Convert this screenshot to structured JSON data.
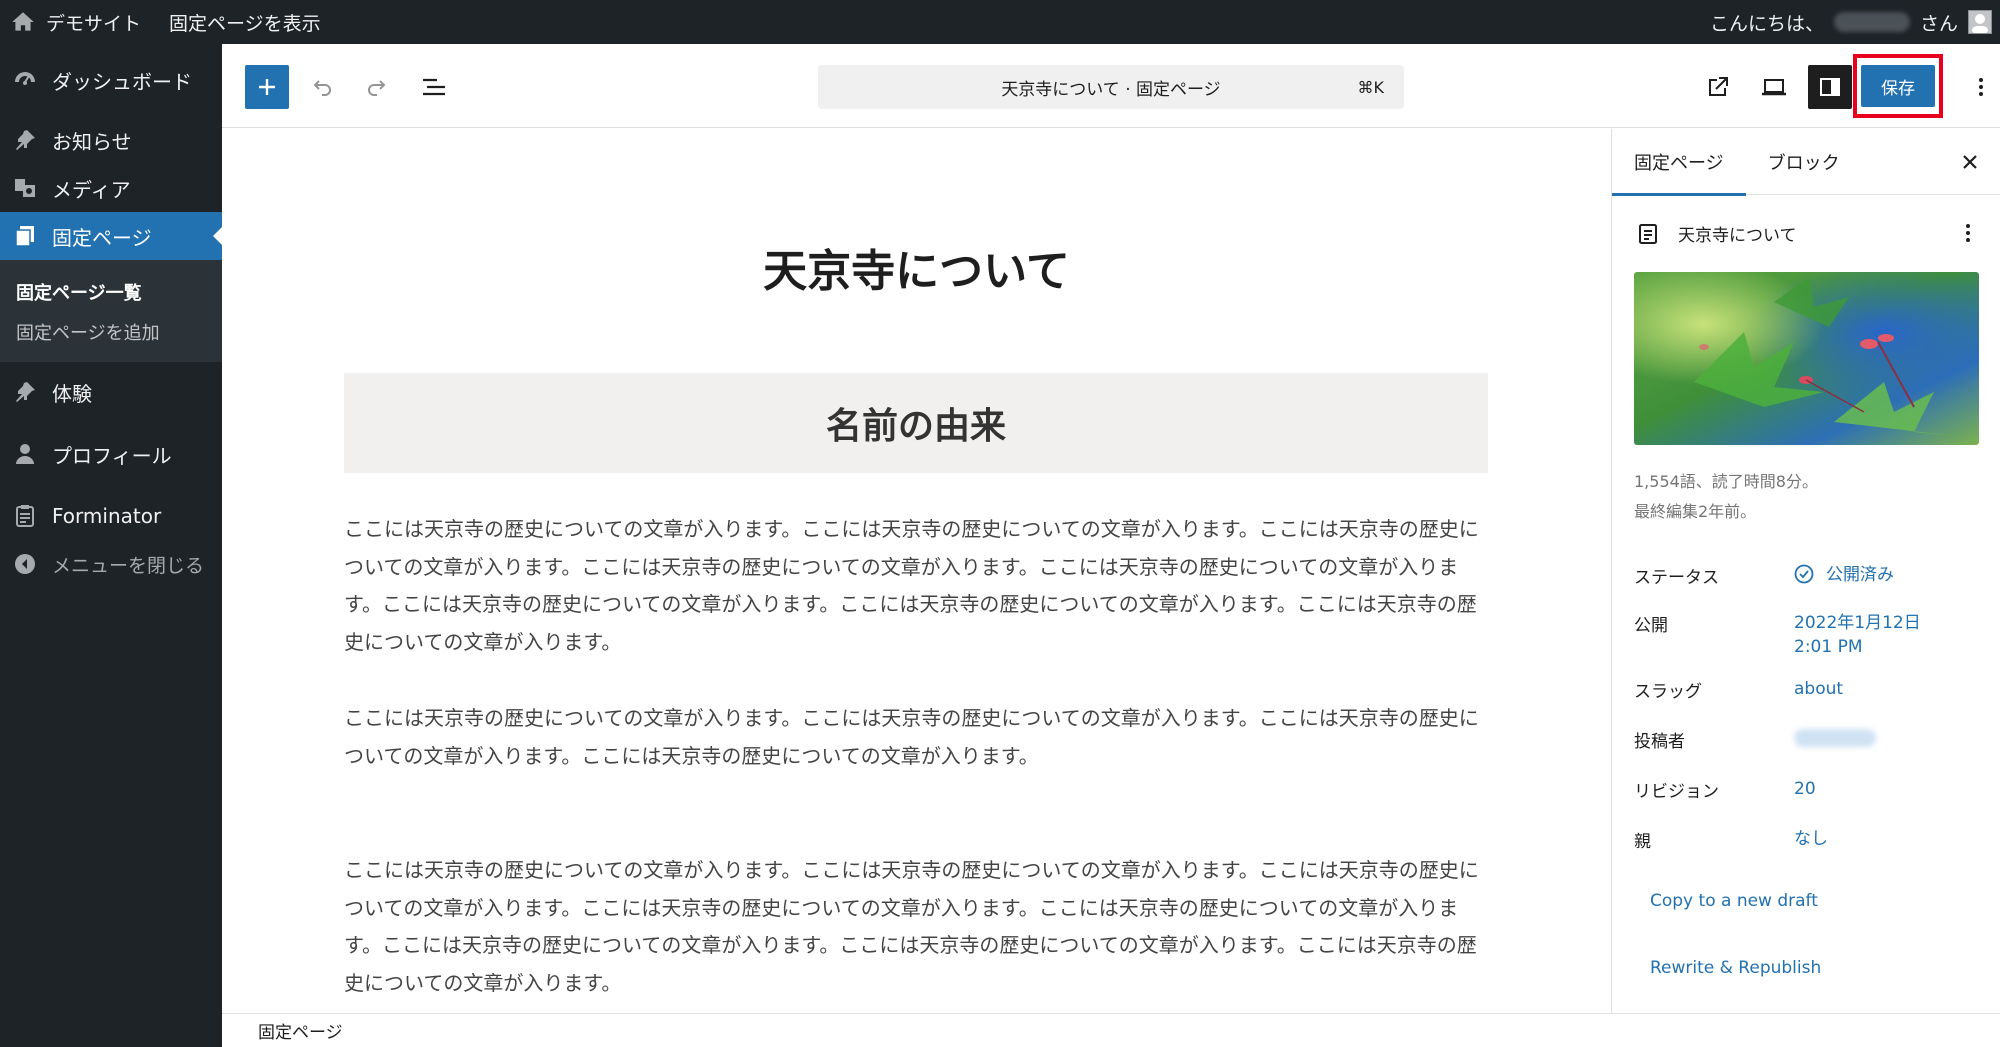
{
  "admin_bar": {
    "site_name": "デモサイト",
    "view_page": "固定ページを表示",
    "greeting": "こんにちは、",
    "suffix": "さん"
  },
  "sidebar": {
    "items": [
      {
        "label": "ダッシュボード",
        "icon": "dashboard-icon"
      },
      {
        "label": "お知らせ",
        "icon": "pin-icon"
      },
      {
        "label": "メディア",
        "icon": "media-icon"
      },
      {
        "label": "固定ページ",
        "icon": "pages-icon"
      },
      {
        "label": "体験",
        "icon": "pin-icon"
      },
      {
        "label": "プロフィール",
        "icon": "user-icon"
      },
      {
        "label": "Forminator",
        "icon": "forminator-icon"
      }
    ],
    "submenu": [
      "固定ページ一覧",
      "固定ページを追加"
    ],
    "collapse_label": "メニューを閉じる"
  },
  "header": {
    "doc_title": "天京寺について · 固定ページ",
    "shortcut": "⌘K",
    "save_label": "保存"
  },
  "content": {
    "title": "天京寺について",
    "heading": "名前の由来",
    "paragraphs": [
      "ここには天京寺の歴史についての文章が入ります。ここには天京寺の歴史についての文章が入ります。ここには天京寺の歴史についての文章が入ります。ここには天京寺の歴史についての文章が入ります。ここには天京寺の歴史についての文章が入ります。ここには天京寺の歴史についての文章が入ります。ここには天京寺の歴史についての文章が入ります。ここには天京寺の歴史についての文章が入ります。",
      "ここには天京寺の歴史についての文章が入ります。ここには天京寺の歴史についての文章が入ります。ここには天京寺の歴史についての文章が入ります。ここには天京寺の歴史についての文章が入ります。",
      "ここには天京寺の歴史についての文章が入ります。ここには天京寺の歴史についての文章が入ります。ここには天京寺の歴史についての文章が入ります。ここには天京寺の歴史についての文章が入ります。ここには天京寺の歴史についての文章が入ります。ここには天京寺の歴史についての文章が入ります。ここには天京寺の歴史についての文章が入ります。ここには天京寺の歴史についての文章が入ります。"
    ]
  },
  "panel": {
    "tab_page": "固定ページ",
    "tab_block": "ブロック",
    "post_title": "天京寺について",
    "stats_words": "1,554語、読了時間8分。",
    "stats_edited": "最終編集2年前。",
    "status_label": "ステータス",
    "status_value": "公開済み",
    "publish_label": "公開",
    "publish_date": "2022年1月12日",
    "publish_time": "2:01 PM",
    "slug_label": "スラッグ",
    "slug_value": "about",
    "author_label": "投稿者",
    "revision_label": "リビジョン",
    "revision_value": "20",
    "parent_label": "親",
    "parent_value": "なし",
    "copy_draft": "Copy to a new draft",
    "rewrite": "Rewrite & Republish"
  },
  "footer": {
    "breadcrumb": "固定ページ"
  },
  "colors": {
    "admin_dark": "#1d2327",
    "accent": "#2271b1",
    "highlight_box": "#e8001c"
  }
}
